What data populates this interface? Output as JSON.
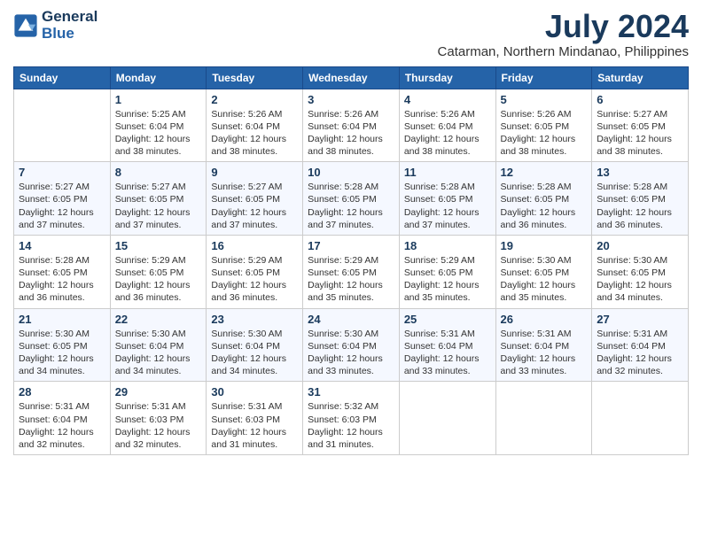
{
  "header": {
    "logo_line1": "General",
    "logo_line2": "Blue",
    "month_year": "July 2024",
    "location": "Catarman, Northern Mindanao, Philippines"
  },
  "days_of_week": [
    "Sunday",
    "Monday",
    "Tuesday",
    "Wednesday",
    "Thursday",
    "Friday",
    "Saturday"
  ],
  "weeks": [
    [
      {
        "day": "",
        "info": ""
      },
      {
        "day": "1",
        "info": "Sunrise: 5:25 AM\nSunset: 6:04 PM\nDaylight: 12 hours\nand 38 minutes."
      },
      {
        "day": "2",
        "info": "Sunrise: 5:26 AM\nSunset: 6:04 PM\nDaylight: 12 hours\nand 38 minutes."
      },
      {
        "day": "3",
        "info": "Sunrise: 5:26 AM\nSunset: 6:04 PM\nDaylight: 12 hours\nand 38 minutes."
      },
      {
        "day": "4",
        "info": "Sunrise: 5:26 AM\nSunset: 6:04 PM\nDaylight: 12 hours\nand 38 minutes."
      },
      {
        "day": "5",
        "info": "Sunrise: 5:26 AM\nSunset: 6:05 PM\nDaylight: 12 hours\nand 38 minutes."
      },
      {
        "day": "6",
        "info": "Sunrise: 5:27 AM\nSunset: 6:05 PM\nDaylight: 12 hours\nand 38 minutes."
      }
    ],
    [
      {
        "day": "7",
        "info": "Sunrise: 5:27 AM\nSunset: 6:05 PM\nDaylight: 12 hours\nand 37 minutes."
      },
      {
        "day": "8",
        "info": "Sunrise: 5:27 AM\nSunset: 6:05 PM\nDaylight: 12 hours\nand 37 minutes."
      },
      {
        "day": "9",
        "info": "Sunrise: 5:27 AM\nSunset: 6:05 PM\nDaylight: 12 hours\nand 37 minutes."
      },
      {
        "day": "10",
        "info": "Sunrise: 5:28 AM\nSunset: 6:05 PM\nDaylight: 12 hours\nand 37 minutes."
      },
      {
        "day": "11",
        "info": "Sunrise: 5:28 AM\nSunset: 6:05 PM\nDaylight: 12 hours\nand 37 minutes."
      },
      {
        "day": "12",
        "info": "Sunrise: 5:28 AM\nSunset: 6:05 PM\nDaylight: 12 hours\nand 36 minutes."
      },
      {
        "day": "13",
        "info": "Sunrise: 5:28 AM\nSunset: 6:05 PM\nDaylight: 12 hours\nand 36 minutes."
      }
    ],
    [
      {
        "day": "14",
        "info": "Sunrise: 5:28 AM\nSunset: 6:05 PM\nDaylight: 12 hours\nand 36 minutes."
      },
      {
        "day": "15",
        "info": "Sunrise: 5:29 AM\nSunset: 6:05 PM\nDaylight: 12 hours\nand 36 minutes."
      },
      {
        "day": "16",
        "info": "Sunrise: 5:29 AM\nSunset: 6:05 PM\nDaylight: 12 hours\nand 36 minutes."
      },
      {
        "day": "17",
        "info": "Sunrise: 5:29 AM\nSunset: 6:05 PM\nDaylight: 12 hours\nand 35 minutes."
      },
      {
        "day": "18",
        "info": "Sunrise: 5:29 AM\nSunset: 6:05 PM\nDaylight: 12 hours\nand 35 minutes."
      },
      {
        "day": "19",
        "info": "Sunrise: 5:30 AM\nSunset: 6:05 PM\nDaylight: 12 hours\nand 35 minutes."
      },
      {
        "day": "20",
        "info": "Sunrise: 5:30 AM\nSunset: 6:05 PM\nDaylight: 12 hours\nand 34 minutes."
      }
    ],
    [
      {
        "day": "21",
        "info": "Sunrise: 5:30 AM\nSunset: 6:05 PM\nDaylight: 12 hours\nand 34 minutes."
      },
      {
        "day": "22",
        "info": "Sunrise: 5:30 AM\nSunset: 6:04 PM\nDaylight: 12 hours\nand 34 minutes."
      },
      {
        "day": "23",
        "info": "Sunrise: 5:30 AM\nSunset: 6:04 PM\nDaylight: 12 hours\nand 34 minutes."
      },
      {
        "day": "24",
        "info": "Sunrise: 5:30 AM\nSunset: 6:04 PM\nDaylight: 12 hours\nand 33 minutes."
      },
      {
        "day": "25",
        "info": "Sunrise: 5:31 AM\nSunset: 6:04 PM\nDaylight: 12 hours\nand 33 minutes."
      },
      {
        "day": "26",
        "info": "Sunrise: 5:31 AM\nSunset: 6:04 PM\nDaylight: 12 hours\nand 33 minutes."
      },
      {
        "day": "27",
        "info": "Sunrise: 5:31 AM\nSunset: 6:04 PM\nDaylight: 12 hours\nand 32 minutes."
      }
    ],
    [
      {
        "day": "28",
        "info": "Sunrise: 5:31 AM\nSunset: 6:04 PM\nDaylight: 12 hours\nand 32 minutes."
      },
      {
        "day": "29",
        "info": "Sunrise: 5:31 AM\nSunset: 6:03 PM\nDaylight: 12 hours\nand 32 minutes."
      },
      {
        "day": "30",
        "info": "Sunrise: 5:31 AM\nSunset: 6:03 PM\nDaylight: 12 hours\nand 31 minutes."
      },
      {
        "day": "31",
        "info": "Sunrise: 5:32 AM\nSunset: 6:03 PM\nDaylight: 12 hours\nand 31 minutes."
      },
      {
        "day": "",
        "info": ""
      },
      {
        "day": "",
        "info": ""
      },
      {
        "day": "",
        "info": ""
      }
    ]
  ]
}
